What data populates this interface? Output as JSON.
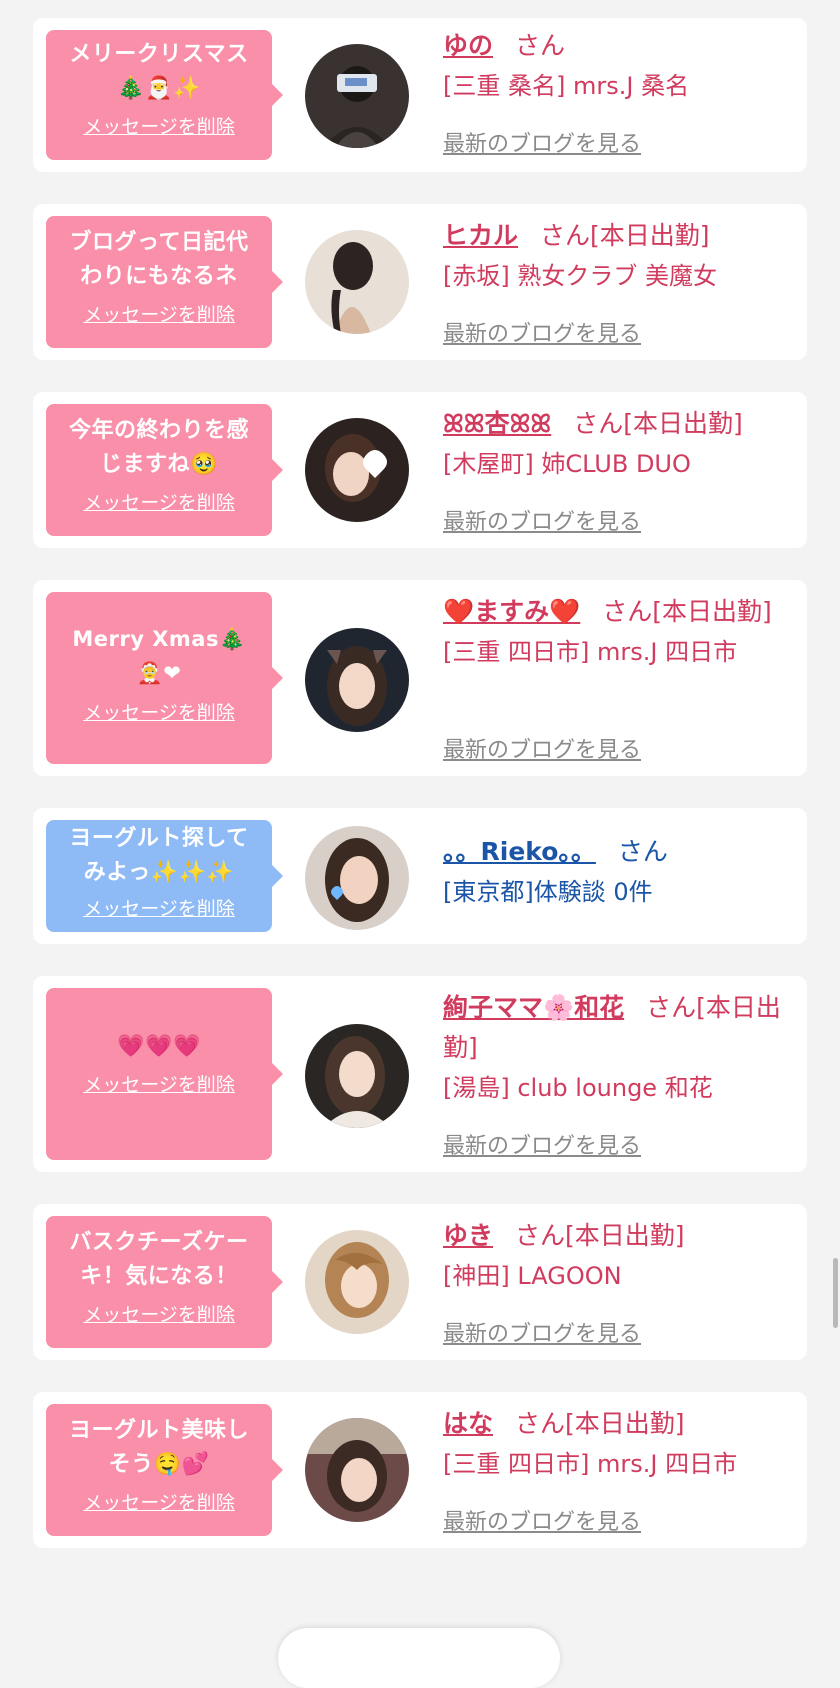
{
  "delete_label": "メッセージを削除",
  "blog_label": "最新のブログを見る",
  "honorific": "さん",
  "items": [
    {
      "message": "メリークリスマス\n🎄🎅✨",
      "name": "ゆの",
      "status": "",
      "shop": "[三重 桑名] mrs.J 桑名",
      "blog": true,
      "color": "pink"
    },
    {
      "message": "ブログって日記代\nわりにもなるネ",
      "name": "ヒカル",
      "status": "[本日出勤]",
      "shop": "[赤坂] 熟女クラブ 美魔女",
      "blog": true,
      "color": "pink"
    },
    {
      "message": "今年の終わりを感\nじますね🥹",
      "name": "ꕤꕤ杏ꕤꕤ",
      "status": "[本日出勤]",
      "shop": "[木屋町] 姉CLUB DUO",
      "blog": true,
      "color": "pink"
    },
    {
      "message": "Merry Xmas🎄\n🤶❤",
      "name": "❤️ますみ❤️",
      "status": "[本日出勤]",
      "shop": "[三重 四日市] mrs.J 四日市",
      "blog": true,
      "color": "pink"
    },
    {
      "message": "ヨーグルト探して\nみよっ✨✨✨",
      "name": "。。Rieko。。",
      "status": "",
      "shop": "[東京都]体験談 0件",
      "blog": false,
      "color": "blue"
    },
    {
      "message": "💗💗💗",
      "name": "絢子ママ🌸和花",
      "status": "[本日出勤]",
      "shop": "[湯島] club lounge 和花",
      "blog": true,
      "color": "pink"
    },
    {
      "message": "バスクチーズケー\nキ！気になる！",
      "name": "ゆき",
      "status": "[本日出勤]",
      "shop": "[神田] LAGOON",
      "blog": true,
      "color": "pink"
    },
    {
      "message": "ヨーグルト美味し\nそう🤤💕",
      "name": "はな",
      "status": "[本日出勤]",
      "shop": "[三重 四日市] mrs.J 四日市",
      "blog": true,
      "color": "pink"
    }
  ]
}
